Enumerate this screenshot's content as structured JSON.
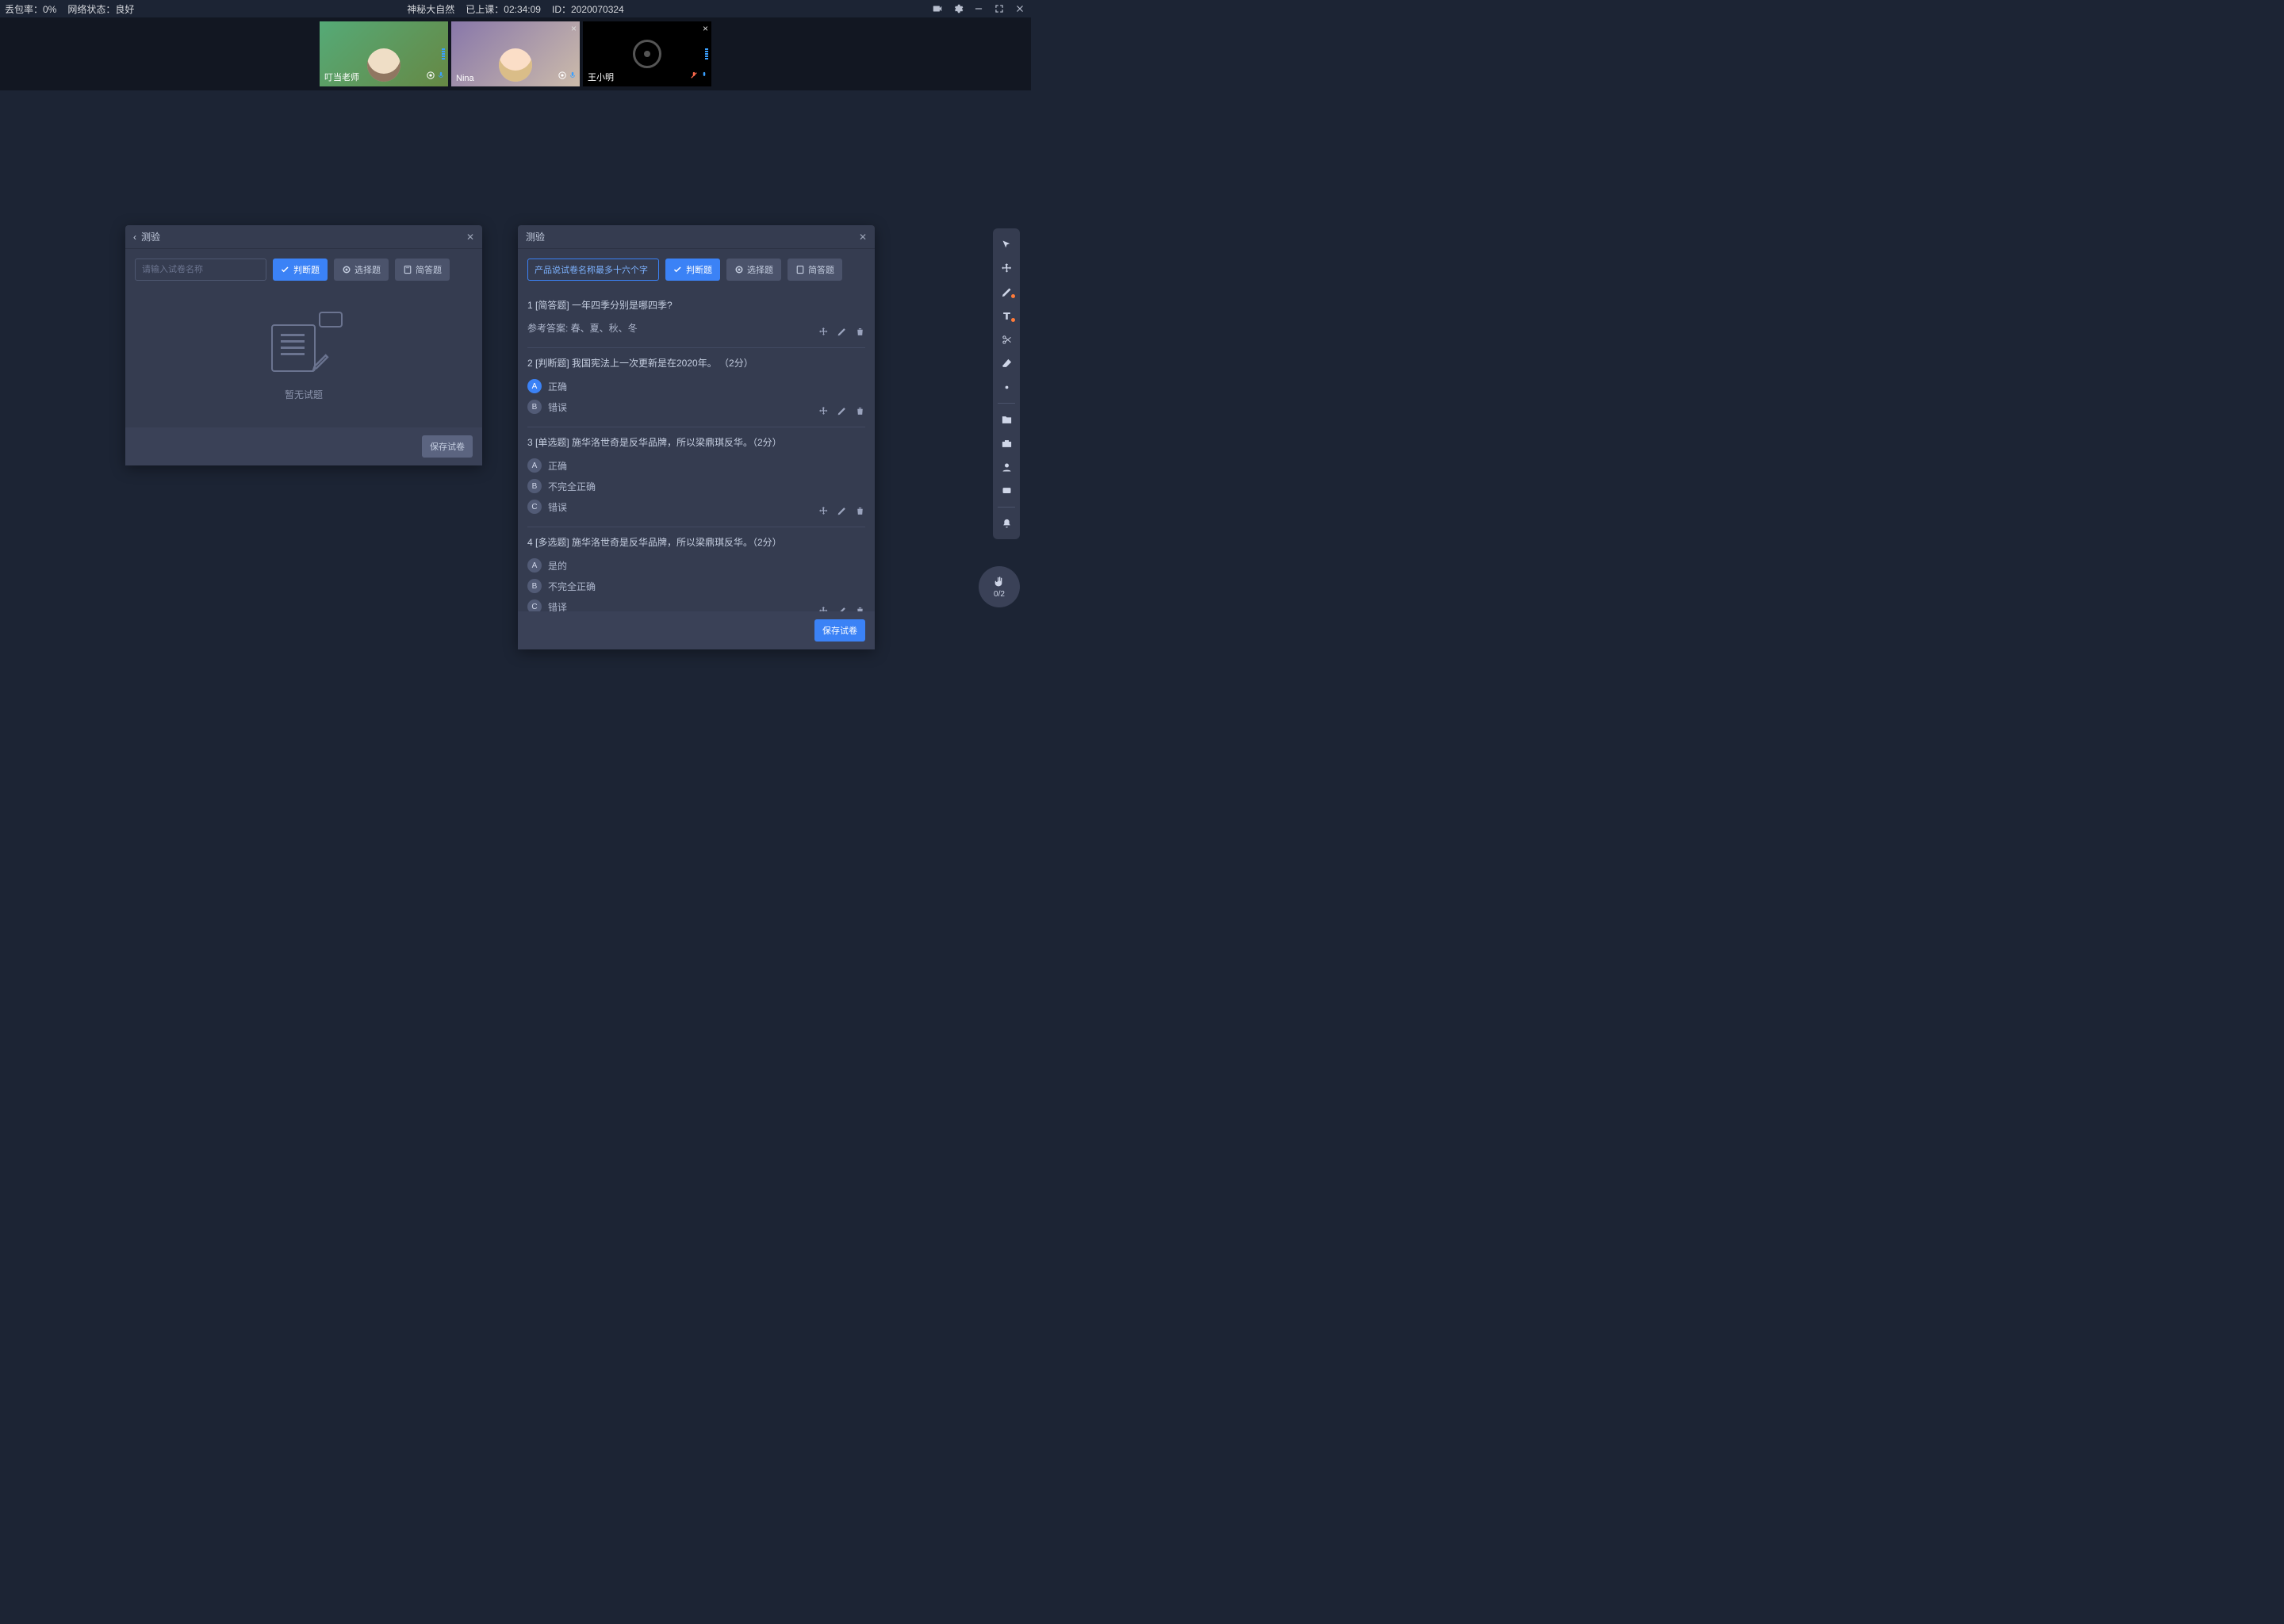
{
  "status": {
    "packet_loss_label": "丢包率：0%",
    "network_label": "网络状态：良好",
    "course_title": "神秘大自然",
    "elapsed_label": "已上课：02:34:09",
    "session_id_label": "ID：2020070324"
  },
  "participants": [
    {
      "name": "叮当老师",
      "teacher": true
    },
    {
      "name": "Nina"
    },
    {
      "name": "王小明",
      "camera_off": true
    }
  ],
  "quiz_left": {
    "title": "测验",
    "name_placeholder": "请输入试卷名称",
    "btn_true_false": "判断题",
    "btn_choice": "选择题",
    "btn_short": "简答题",
    "empty_text": "暂无试题",
    "save_label": "保存试卷"
  },
  "quiz_right": {
    "title": "测验",
    "name_value": "产品说试卷名称最多十六个字",
    "btn_true_false": "判断题",
    "btn_choice": "选择题",
    "btn_short": "简答题",
    "save_label": "保存试卷",
    "questions": [
      {
        "header": "1 [简答题] 一年四季分别是哪四季?",
        "answer_label": "参考答案:  春、夏、秋、冬"
      },
      {
        "header": "2 [判断题] 我国宪法上一次更新是在2020年。 （2分）",
        "options": [
          {
            "badge": "A",
            "text": "正确",
            "selected": true
          },
          {
            "badge": "B",
            "text": "错误"
          }
        ]
      },
      {
        "header": "3 [单选题] 施华洛世奇是反华品牌，所以梁鼎琪反华。（2分）",
        "options": [
          {
            "badge": "A",
            "text": "正确"
          },
          {
            "badge": "B",
            "text": "不完全正确"
          },
          {
            "badge": "C",
            "text": "错误"
          }
        ]
      },
      {
        "header": "4 [多选题] 施华洛世奇是反华品牌，所以梁鼎琪反华。（2分）",
        "options": [
          {
            "badge": "A",
            "text": "是的"
          },
          {
            "badge": "B",
            "text": "不完全正确"
          },
          {
            "badge": "C",
            "text": "错译"
          }
        ]
      }
    ]
  },
  "hand_raise": {
    "count": "0/2"
  }
}
